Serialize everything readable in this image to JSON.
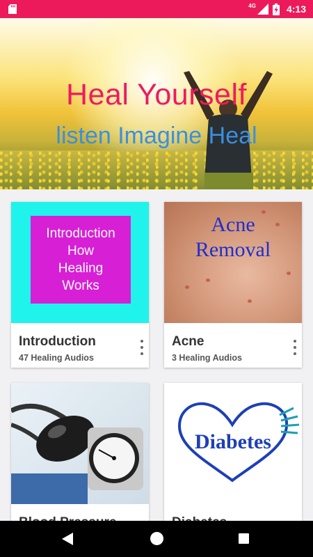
{
  "status_bar": {
    "network": "4G",
    "time": "4:13",
    "icons": [
      "sd-card-icon",
      "signal-icon",
      "battery-charging-icon"
    ],
    "color": "#ec1a5a"
  },
  "hero": {
    "title": "Heal Yourself",
    "subtitle": "listen Imagine Heal",
    "title_color": "#ee1a62",
    "subtitle_color": "#3a8fe0"
  },
  "cards": [
    {
      "title": "Introduction",
      "subtitle": "47 Healing Audios",
      "image_text": "Introduction\nHow\nHealing\nWorks",
      "more_icon": "more-vert-icon"
    },
    {
      "title": "Acne",
      "subtitle": "3 Healing Audios",
      "image_line1": "Acne",
      "image_line2": "Removal",
      "more_icon": "more-vert-icon"
    },
    {
      "title": "Blood Pressure",
      "image": "blood-pressure-monitor"
    },
    {
      "title": "Diabetes",
      "image_text": "Diabetes"
    }
  ],
  "nav_bar": {
    "icons": [
      "back-icon",
      "home-icon",
      "recent-apps-icon"
    ]
  }
}
